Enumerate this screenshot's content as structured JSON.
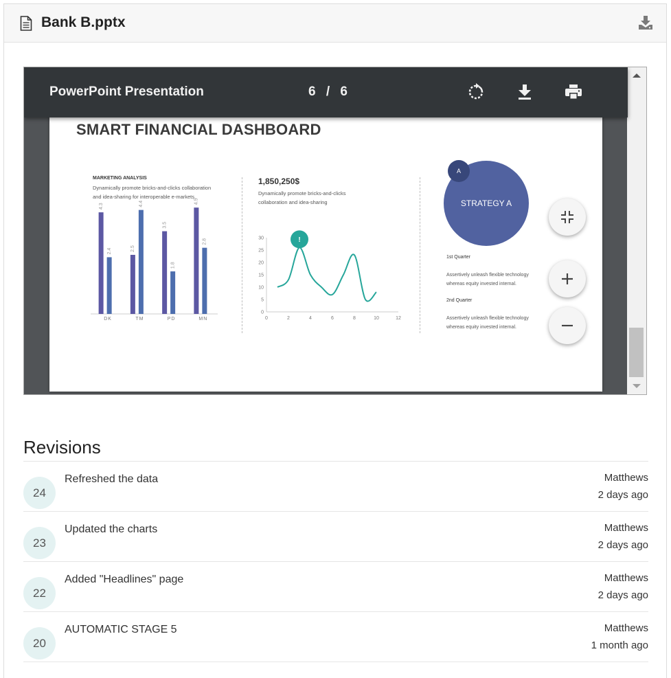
{
  "header": {
    "file_name": "Bank B.pptx",
    "file_icon": "document-icon",
    "download_icon": "download-icon"
  },
  "viewer": {
    "title": "PowerPoint Presentation",
    "current_page": "6",
    "separator": "/",
    "total_pages": "6",
    "rotate_icon": "rotate-icon",
    "download_icon": "download-icon",
    "print_icon": "print-icon",
    "zoom_fit_icon": "fit-to-page-icon",
    "zoom_in_icon": "plus-icon",
    "zoom_out_icon": "minus-icon"
  },
  "slide": {
    "title": "SMART FINANCIAL DASHBOARD",
    "marketing_heading": "MARKETING ANALYSIS",
    "marketing_text": "Dynamically promote bricks-and-clicks collaboration and idea-sharing for interoperable e-markets.",
    "figure": "1,850,250$",
    "figure_text": "Dynamically promote bricks-and-clicks collaboration and idea-sharing",
    "strategy_label": "STRATEGY A",
    "strategy_badge": "A",
    "q1_label": "1st Quarter",
    "q1_text": "Assertively unleash flexible technology whereas equity invested internal.",
    "q2_label": "2nd Quarter",
    "q2_text": "Assertively unleash flexible technology whereas equity invested internal.",
    "marker_label": "!"
  },
  "chart_data": [
    {
      "type": "bar",
      "title": "",
      "categories": [
        "DK",
        "TM",
        "PD",
        "MN"
      ],
      "series": [
        {
          "values": [
            4.3,
            2.5,
            3.5,
            4.5
          ]
        },
        {
          "values": [
            2.4,
            4.4,
            1.8,
            2.8
          ]
        }
      ],
      "ylim": [
        0,
        5
      ],
      "colors": [
        "#5c58a3",
        "#4d6eae"
      ]
    },
    {
      "type": "line",
      "title": "",
      "x": [
        1,
        2,
        3,
        4,
        5,
        6,
        7,
        8,
        9,
        10
      ],
      "values": [
        10,
        13,
        26,
        15,
        10,
        7,
        15,
        23,
        5,
        8
      ],
      "x_ticks": [
        0,
        2,
        4,
        6,
        8,
        10,
        12
      ],
      "y_ticks": [
        0,
        5,
        10,
        15,
        20,
        25,
        30
      ],
      "xlim": [
        0,
        12
      ],
      "ylim": [
        0,
        30
      ],
      "color": "#26a69a"
    }
  ],
  "revisions": {
    "title": "Revisions",
    "items": [
      {
        "number": "24",
        "description": "Refreshed the data",
        "author": "Matthews",
        "time": "2 days ago"
      },
      {
        "number": "23",
        "description": "Updated the charts",
        "author": "Matthews",
        "time": "2 days ago"
      },
      {
        "number": "22",
        "description": "Added \"Headlines\" page",
        "author": "Matthews",
        "time": "2 days ago"
      },
      {
        "number": "20",
        "description": "AUTOMATIC STAGE 5",
        "author": "Matthews",
        "time": "1 month ago"
      }
    ]
  }
}
